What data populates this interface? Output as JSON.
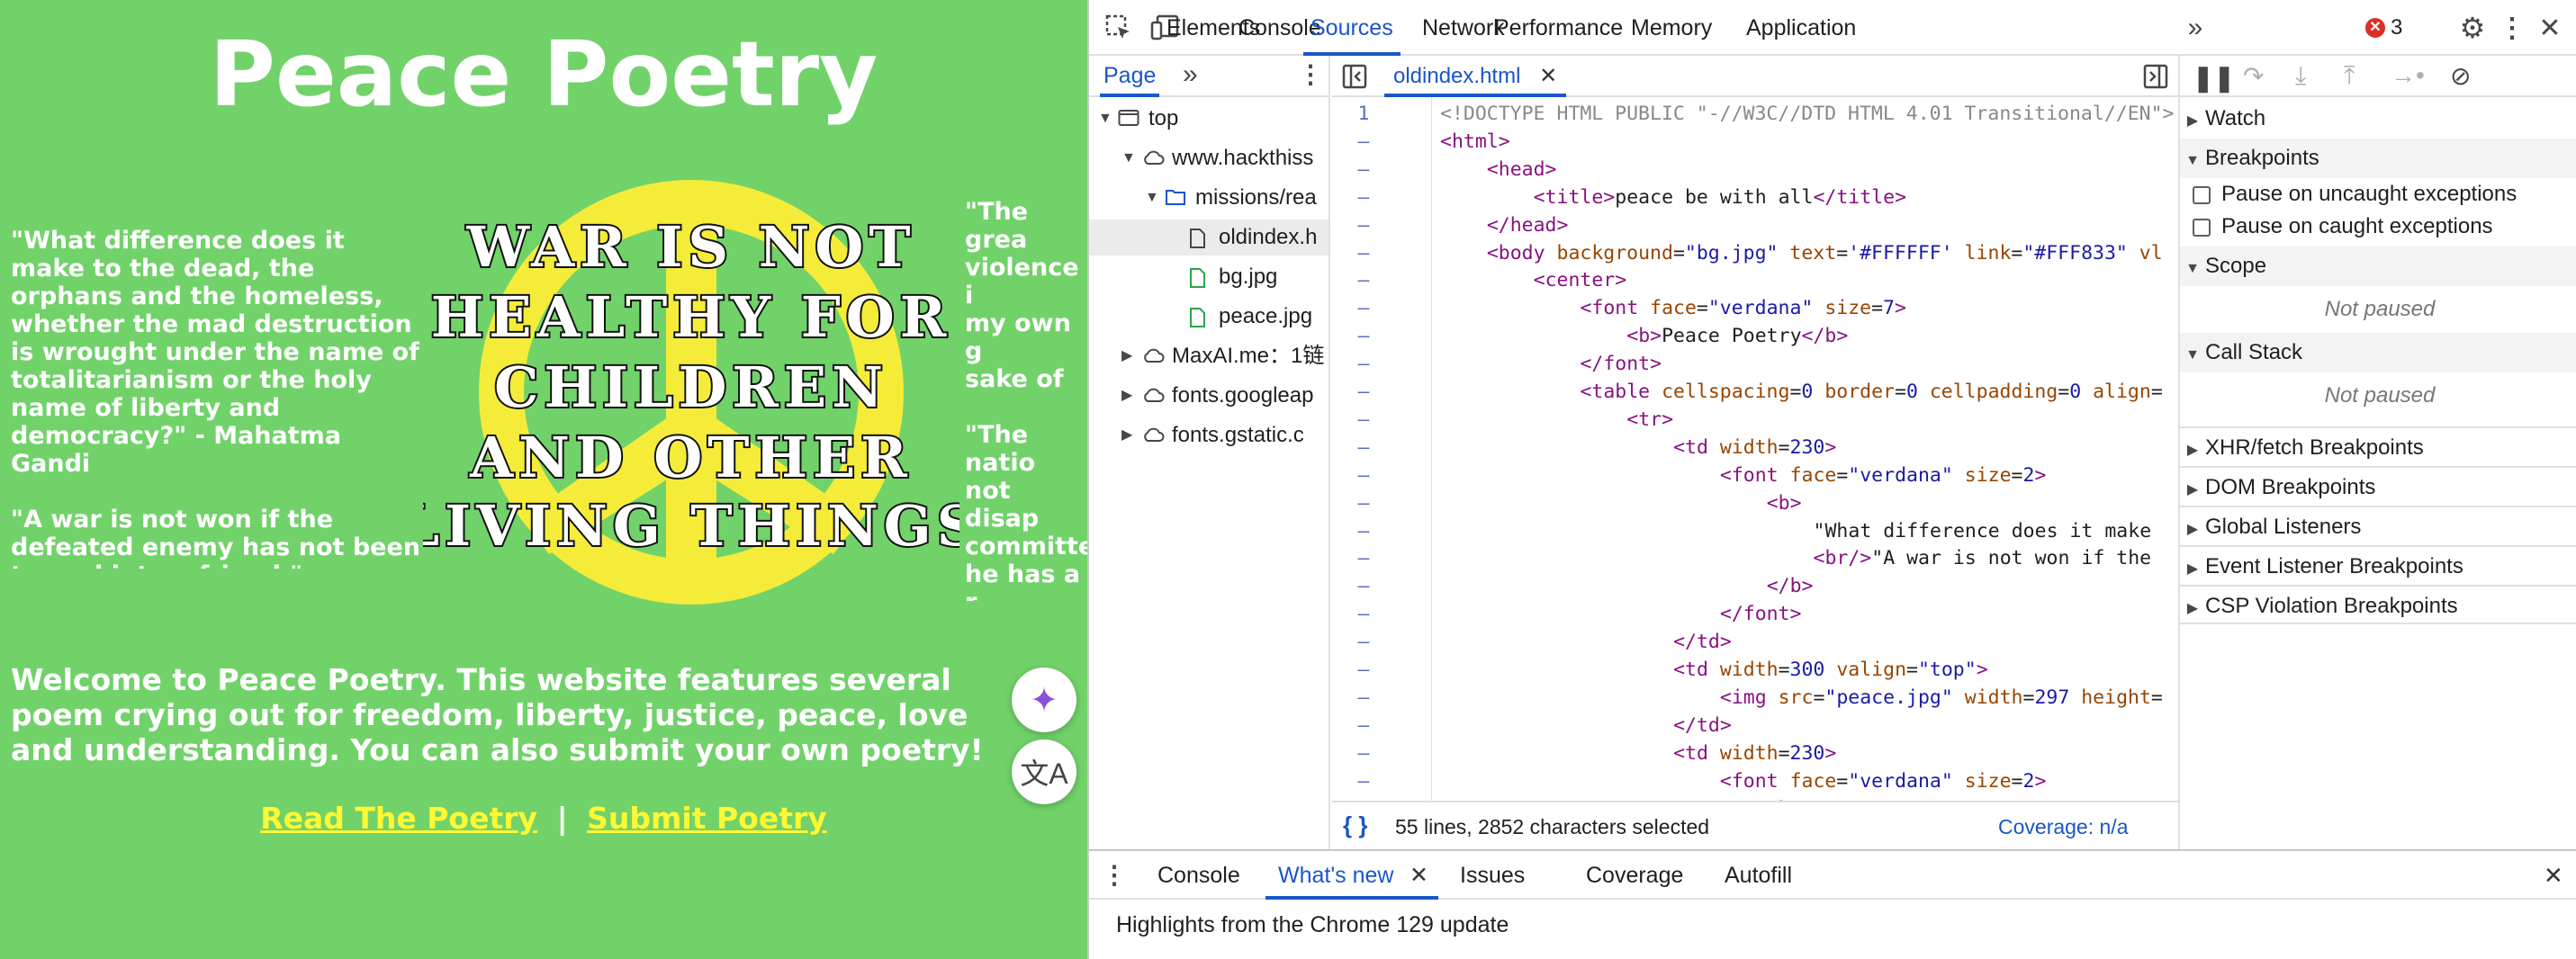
{
  "page": {
    "title": "Peace Poetry",
    "left_quote": "\"What difference does it make to the dead, the orphans and the homeless, whether the mad destruction is wrought under the name of totalitarianism or the holy name of liberty and democracy?\" - Mahatma Gandi\n\n\"A war is not won if the defeated enemy has not been turned into a friend.\"",
    "right_quote_1": "\"The grea\nviolence i\nmy own g\nsake of h\ntrembling\ncannot be\nLuther Ki",
    "right_quote_2": "\"The natio\nnot disap\ncommitte\nhe has a r\nfor not ev\nthem.\" - G",
    "peace_text": [
      "WAR IS NOT",
      "HEALTHY FOR",
      "CHILDREN",
      "AND OTHER",
      "LIVING THINGS"
    ],
    "welcome": "Welcome to Peace Poetry. This website features several poem crying out for freedom, liberty, justice, peace, love and understanding. You can also submit your own poetry!",
    "link_read": "Read The Poetry",
    "link_separator": "|",
    "link_submit": "Submit Poetry",
    "colors": {
      "background": "#71d26a",
      "link": "#fff833",
      "text": "#ffffff"
    }
  },
  "devtools": {
    "tabs": [
      "Elements",
      "Console",
      "Sources",
      "Network",
      "Performance",
      "Memory",
      "Application"
    ],
    "active_tab": "Sources",
    "error_count": "3",
    "navigator": {
      "tab_label": "Page",
      "tree": [
        {
          "label": "top",
          "depth": 0,
          "icon": "frame-icon",
          "arrow": "▼"
        },
        {
          "label": "www.hackthiss",
          "depth": 1,
          "icon": "cloud-icon",
          "arrow": "▼"
        },
        {
          "label": "missions/rea",
          "depth": 2,
          "icon": "folder-icon",
          "arrow": "▼"
        },
        {
          "label": "oldindex.h",
          "depth": 3,
          "icon": "file-icon",
          "arrow": "",
          "selected": true
        },
        {
          "label": "bg.jpg",
          "depth": 3,
          "icon": "image-file-icon",
          "arrow": ""
        },
        {
          "label": "peace.jpg",
          "depth": 3,
          "icon": "image-file-icon",
          "arrow": ""
        },
        {
          "label": "MaxAI.me：1链",
          "depth": 1,
          "icon": "cloud-icon",
          "arrow": "▶"
        },
        {
          "label": "fonts.googleap",
          "depth": 1,
          "icon": "cloud-icon",
          "arrow": "▶"
        },
        {
          "label": "fonts.gstatic.c",
          "depth": 1,
          "icon": "cloud-icon",
          "arrow": "▶"
        }
      ]
    },
    "editor": {
      "file_tab": "oldindex.html",
      "line_number": "1",
      "line_marker": "–",
      "lines": [
        "<!DOCTYPE HTML PUBLIC \"-//W3C//DTD HTML 4.01 Transitional//EN\">",
        "<html>",
        "    <head>",
        "        <title>peace be with all</title>",
        "    </head>",
        "    <body background=\"bg.jpg\" text='#FFFFFF' link=\"#FFF833\" vl",
        "        <center>",
        "            <font face=\"verdana\" size=7>",
        "                <b>Peace Poetry</b>",
        "            </font>",
        "            <table cellspacing=0 border=0 cellpadding=0 align=",
        "                <tr>",
        "                    <td width=230>",
        "                        <font face=\"verdana\" size=2>",
        "                            <b>",
        "                                \"What difference does it make",
        "                                <br/>\"A war is not won if the",
        "                            </b>",
        "                        </font>",
        "                    </td>",
        "                    <td width=300 valign=\"top\">",
        "                        <img src=\"peace.jpg\" width=297 height=",
        "                    </td>",
        "                    <td width=230>",
        "                        <font face=\"verdana\" size=2>",
        "                            <b>"
      ],
      "status": "55 lines, 2852 characters selected",
      "coverage": "Coverage: n/a"
    },
    "debugger": {
      "watch": "Watch",
      "breakpoints": "Breakpoints",
      "pause_uncaught": "Pause on uncaught exceptions",
      "pause_caught": "Pause on caught exceptions",
      "scope": "Scope",
      "not_paused": "Not paused",
      "call_stack": "Call Stack",
      "xhr": "XHR/fetch Breakpoints",
      "dom": "DOM Breakpoints",
      "global": "Global Listeners",
      "event": "Event Listener Breakpoints",
      "csp": "CSP Violation Breakpoints"
    },
    "drawer": {
      "tabs": [
        "Console",
        "What's new",
        "Issues",
        "Coverage",
        "Autofill"
      ],
      "active_tab": "What's new",
      "content": "Highlights from the Chrome 129 update"
    },
    "colors": {
      "accent": "#1a56c9",
      "error": "#d93025"
    }
  }
}
